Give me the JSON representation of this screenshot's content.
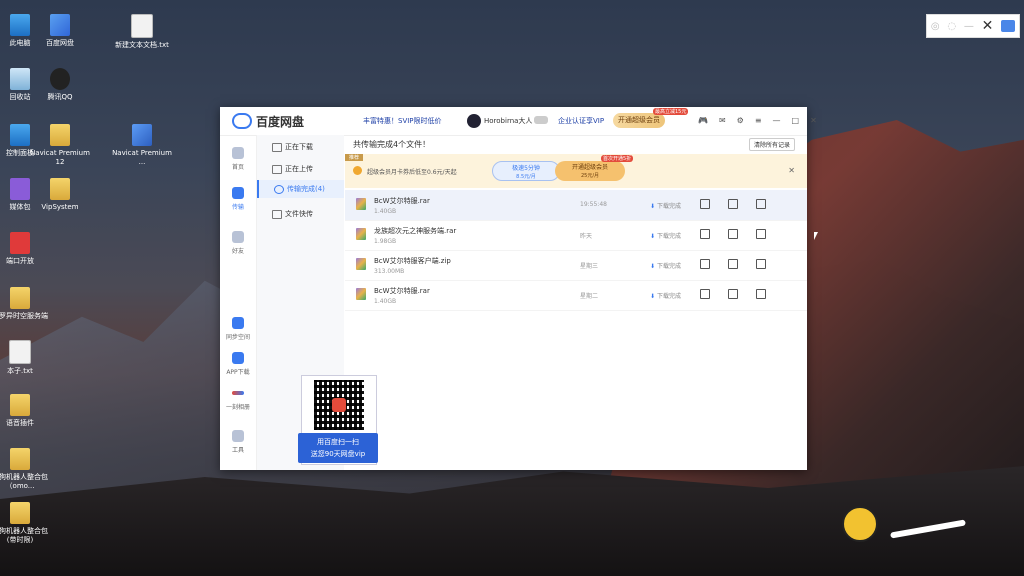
{
  "desktop": {
    "icons": [
      {
        "label": "此电脑",
        "kind": "pc"
      },
      {
        "label": "百度网盘",
        "kind": "app"
      },
      {
        "label": "新建文本文档.txt",
        "kind": "file"
      },
      {
        "label": "回收站",
        "kind": "bin"
      },
      {
        "label": "腾讯QQ",
        "kind": "app"
      },
      {
        "label": "控制面板",
        "kind": "pc"
      },
      {
        "label": "Navicat Premium 12",
        "kind": "folder"
      },
      {
        "label": "Navicat Premium ...",
        "kind": "navi"
      },
      {
        "label": "媒体包",
        "kind": "app"
      },
      {
        "label": "VipSystem",
        "kind": "folder"
      },
      {
        "label": "端口开放",
        "kind": "red"
      },
      {
        "label": "斗罗异时空服务端",
        "kind": "folder"
      },
      {
        "label": "本子.txt",
        "kind": "file"
      },
      {
        "label": "语音插件",
        "kind": "folder"
      },
      {
        "label": "二狗机器人整合包（omo...",
        "kind": "folder"
      },
      {
        "label": "二狗机器人整合包(带时限)",
        "kind": "folder"
      }
    ]
  },
  "baidu": {
    "app_title": "百度网盘",
    "promo_text": "丰富特惠！SVIP限时低价",
    "username": "Horobirna大人",
    "enterprise_link": "企业认证享VIP",
    "open_vip": "开通超级会员",
    "hot_badge": "最高立减15元",
    "sidebar": [
      {
        "label": "首页"
      },
      {
        "label": "传输"
      },
      {
        "label": "好友"
      },
      {
        "label": "同步空间"
      },
      {
        "label": "APP下载"
      },
      {
        "label": "一刻相册"
      },
      {
        "label": "工具"
      }
    ],
    "nav": [
      {
        "label": "正在下载"
      },
      {
        "label": "正在上传"
      },
      {
        "label": "传输完成(4)"
      },
      {
        "label": "文件快传"
      }
    ],
    "qr_banner_line1": "用百度扫一扫",
    "qr_banner_line2": "送您90天网盘vip",
    "main_title": "共传输完成4个文件！",
    "clear_button": "清除所有记录",
    "promo_tag": "推荐",
    "promo_message": "超级会员月卡券后低至0.6元/天起",
    "promo_btn1_line1": "极速5分钟",
    "promo_btn1_line2": "8.5元/月",
    "promo_btn2_line1": "开通超级会员",
    "promo_btn2_line2": "25元/月",
    "promo_hot": "首次开通5折",
    "files": [
      {
        "name": "BcW艾尔特服.rar",
        "size": "1.40GB",
        "time": "19:55:48",
        "status": "下载完成"
      },
      {
        "name": "龙族超次元之神服务端.rar",
        "size": "1.98GB",
        "time": "昨天",
        "status": "下载完成"
      },
      {
        "name": "BcW艾尔特服客户端.zip",
        "size": "313.00MB",
        "time": "星期三",
        "status": "下载完成"
      },
      {
        "name": "BcW艾尔特服.rar",
        "size": "1.40GB",
        "time": "星期二",
        "status": "下载完成"
      }
    ]
  }
}
